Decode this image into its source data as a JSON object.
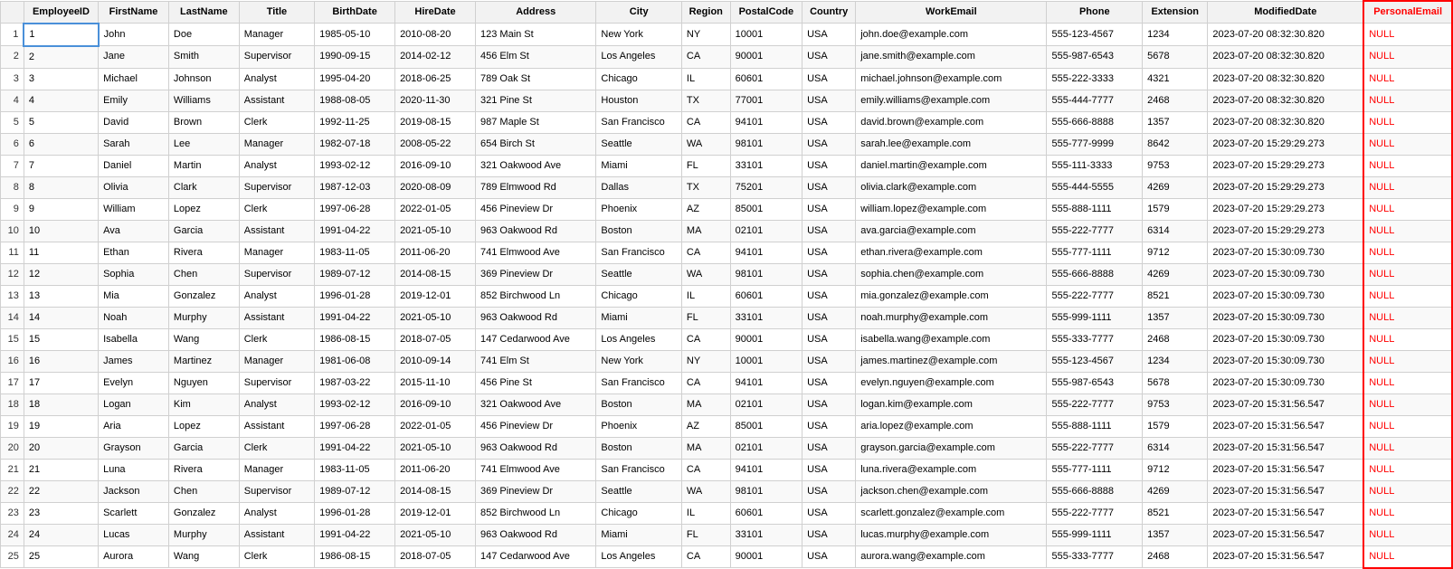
{
  "columns": [
    {
      "key": "rownum",
      "label": "",
      "class": ""
    },
    {
      "key": "EmployeeID",
      "label": "EmployeeID",
      "class": "col-employeeid"
    },
    {
      "key": "FirstName",
      "label": "FirstName",
      "class": "col-firstname"
    },
    {
      "key": "LastName",
      "label": "LastName",
      "class": "col-lastname"
    },
    {
      "key": "Title",
      "label": "Title",
      "class": "col-title"
    },
    {
      "key": "BirthDate",
      "label": "BirthDate",
      "class": "col-birthdate"
    },
    {
      "key": "HireDate",
      "label": "HireDate",
      "class": "col-hiredate"
    },
    {
      "key": "Address",
      "label": "Address",
      "class": "col-address"
    },
    {
      "key": "City",
      "label": "City",
      "class": "col-city"
    },
    {
      "key": "Region",
      "label": "Region",
      "class": "col-region"
    },
    {
      "key": "PostalCode",
      "label": "PostalCode",
      "class": "col-postalcode"
    },
    {
      "key": "Country",
      "label": "Country",
      "class": "col-country"
    },
    {
      "key": "WorkEmail",
      "label": "WorkEmail",
      "class": "col-workemail"
    },
    {
      "key": "Phone",
      "label": "Phone",
      "class": "col-phone"
    },
    {
      "key": "Extension",
      "label": "Extension",
      "class": "col-extension"
    },
    {
      "key": "ModifiedDate",
      "label": "ModifiedDate",
      "class": "col-modifieddate"
    },
    {
      "key": "PersonalEmail",
      "label": "PersonalEmail",
      "class": "col-personalemail"
    }
  ],
  "rows": [
    {
      "rownum": "1",
      "EmployeeID": "1",
      "FirstName": "John",
      "LastName": "Doe",
      "Title": "Manager",
      "BirthDate": "1985-05-10",
      "HireDate": "2010-08-20",
      "Address": "123 Main St",
      "City": "New York",
      "Region": "NY",
      "PostalCode": "10001",
      "Country": "USA",
      "WorkEmail": "john.doe@example.com",
      "Phone": "555-123-4567",
      "Extension": "1234",
      "ModifiedDate": "2023-07-20 08:32:30.820",
      "PersonalEmail": "NULL"
    },
    {
      "rownum": "2",
      "EmployeeID": "2",
      "FirstName": "Jane",
      "LastName": "Smith",
      "Title": "Supervisor",
      "BirthDate": "1990-09-15",
      "HireDate": "2014-02-12",
      "Address": "456 Elm St",
      "City": "Los Angeles",
      "Region": "CA",
      "PostalCode": "90001",
      "Country": "USA",
      "WorkEmail": "jane.smith@example.com",
      "Phone": "555-987-6543",
      "Extension": "5678",
      "ModifiedDate": "2023-07-20 08:32:30.820",
      "PersonalEmail": "NULL"
    },
    {
      "rownum": "3",
      "EmployeeID": "3",
      "FirstName": "Michael",
      "LastName": "Johnson",
      "Title": "Analyst",
      "BirthDate": "1995-04-20",
      "HireDate": "2018-06-25",
      "Address": "789 Oak St",
      "City": "Chicago",
      "Region": "IL",
      "PostalCode": "60601",
      "Country": "USA",
      "WorkEmail": "michael.johnson@example.com",
      "Phone": "555-222-3333",
      "Extension": "4321",
      "ModifiedDate": "2023-07-20 08:32:30.820",
      "PersonalEmail": "NULL"
    },
    {
      "rownum": "4",
      "EmployeeID": "4",
      "FirstName": "Emily",
      "LastName": "Williams",
      "Title": "Assistant",
      "BirthDate": "1988-08-05",
      "HireDate": "2020-11-30",
      "Address": "321 Pine St",
      "City": "Houston",
      "Region": "TX",
      "PostalCode": "77001",
      "Country": "USA",
      "WorkEmail": "emily.williams@example.com",
      "Phone": "555-444-7777",
      "Extension": "2468",
      "ModifiedDate": "2023-07-20 08:32:30.820",
      "PersonalEmail": "NULL"
    },
    {
      "rownum": "5",
      "EmployeeID": "5",
      "FirstName": "David",
      "LastName": "Brown",
      "Title": "Clerk",
      "BirthDate": "1992-11-25",
      "HireDate": "2019-08-15",
      "Address": "987 Maple St",
      "City": "San Francisco",
      "Region": "CA",
      "PostalCode": "94101",
      "Country": "USA",
      "WorkEmail": "david.brown@example.com",
      "Phone": "555-666-8888",
      "Extension": "1357",
      "ModifiedDate": "2023-07-20 08:32:30.820",
      "PersonalEmail": "NULL"
    },
    {
      "rownum": "6",
      "EmployeeID": "6",
      "FirstName": "Sarah",
      "LastName": "Lee",
      "Title": "Manager",
      "BirthDate": "1982-07-18",
      "HireDate": "2008-05-22",
      "Address": "654 Birch St",
      "City": "Seattle",
      "Region": "WA",
      "PostalCode": "98101",
      "Country": "USA",
      "WorkEmail": "sarah.lee@example.com",
      "Phone": "555-777-9999",
      "Extension": "8642",
      "ModifiedDate": "2023-07-20 15:29:29.273",
      "PersonalEmail": "NULL"
    },
    {
      "rownum": "7",
      "EmployeeID": "7",
      "FirstName": "Daniel",
      "LastName": "Martin",
      "Title": "Analyst",
      "BirthDate": "1993-02-12",
      "HireDate": "2016-09-10",
      "Address": "321 Oakwood Ave",
      "City": "Miami",
      "Region": "FL",
      "PostalCode": "33101",
      "Country": "USA",
      "WorkEmail": "daniel.martin@example.com",
      "Phone": "555-111-3333",
      "Extension": "9753",
      "ModifiedDate": "2023-07-20 15:29:29.273",
      "PersonalEmail": "NULL"
    },
    {
      "rownum": "8",
      "EmployeeID": "8",
      "FirstName": "Olivia",
      "LastName": "Clark",
      "Title": "Supervisor",
      "BirthDate": "1987-12-03",
      "HireDate": "2020-08-09",
      "Address": "789 Elmwood Rd",
      "City": "Dallas",
      "Region": "TX",
      "PostalCode": "75201",
      "Country": "USA",
      "WorkEmail": "olivia.clark@example.com",
      "Phone": "555-444-5555",
      "Extension": "4269",
      "ModifiedDate": "2023-07-20 15:29:29.273",
      "PersonalEmail": "NULL"
    },
    {
      "rownum": "9",
      "EmployeeID": "9",
      "FirstName": "William",
      "LastName": "Lopez",
      "Title": "Clerk",
      "BirthDate": "1997-06-28",
      "HireDate": "2022-01-05",
      "Address": "456 Pineview Dr",
      "City": "Phoenix",
      "Region": "AZ",
      "PostalCode": "85001",
      "Country": "USA",
      "WorkEmail": "william.lopez@example.com",
      "Phone": "555-888-1111",
      "Extension": "1579",
      "ModifiedDate": "2023-07-20 15:29:29.273",
      "PersonalEmail": "NULL"
    },
    {
      "rownum": "10",
      "EmployeeID": "10",
      "FirstName": "Ava",
      "LastName": "Garcia",
      "Title": "Assistant",
      "BirthDate": "1991-04-22",
      "HireDate": "2021-05-10",
      "Address": "963 Oakwood Rd",
      "City": "Boston",
      "Region": "MA",
      "PostalCode": "02101",
      "Country": "USA",
      "WorkEmail": "ava.garcia@example.com",
      "Phone": "555-222-7777",
      "Extension": "6314",
      "ModifiedDate": "2023-07-20 15:29:29.273",
      "PersonalEmail": "NULL"
    },
    {
      "rownum": "11",
      "EmployeeID": "11",
      "FirstName": "Ethan",
      "LastName": "Rivera",
      "Title": "Manager",
      "BirthDate": "1983-11-05",
      "HireDate": "2011-06-20",
      "Address": "741 Elmwood Ave",
      "City": "San Francisco",
      "Region": "CA",
      "PostalCode": "94101",
      "Country": "USA",
      "WorkEmail": "ethan.rivera@example.com",
      "Phone": "555-777-1111",
      "Extension": "9712",
      "ModifiedDate": "2023-07-20 15:30:09.730",
      "PersonalEmail": "NULL"
    },
    {
      "rownum": "12",
      "EmployeeID": "12",
      "FirstName": "Sophia",
      "LastName": "Chen",
      "Title": "Supervisor",
      "BirthDate": "1989-07-12",
      "HireDate": "2014-08-15",
      "Address": "369 Pineview Dr",
      "City": "Seattle",
      "Region": "WA",
      "PostalCode": "98101",
      "Country": "USA",
      "WorkEmail": "sophia.chen@example.com",
      "Phone": "555-666-8888",
      "Extension": "4269",
      "ModifiedDate": "2023-07-20 15:30:09.730",
      "PersonalEmail": "NULL"
    },
    {
      "rownum": "13",
      "EmployeeID": "13",
      "FirstName": "Mia",
      "LastName": "Gonzalez",
      "Title": "Analyst",
      "BirthDate": "1996-01-28",
      "HireDate": "2019-12-01",
      "Address": "852 Birchwood Ln",
      "City": "Chicago",
      "Region": "IL",
      "PostalCode": "60601",
      "Country": "USA",
      "WorkEmail": "mia.gonzalez@example.com",
      "Phone": "555-222-7777",
      "Extension": "8521",
      "ModifiedDate": "2023-07-20 15:30:09.730",
      "PersonalEmail": "NULL"
    },
    {
      "rownum": "14",
      "EmployeeID": "14",
      "FirstName": "Noah",
      "LastName": "Murphy",
      "Title": "Assistant",
      "BirthDate": "1991-04-22",
      "HireDate": "2021-05-10",
      "Address": "963 Oakwood Rd",
      "City": "Miami",
      "Region": "FL",
      "PostalCode": "33101",
      "Country": "USA",
      "WorkEmail": "noah.murphy@example.com",
      "Phone": "555-999-1111",
      "Extension": "1357",
      "ModifiedDate": "2023-07-20 15:30:09.730",
      "PersonalEmail": "NULL"
    },
    {
      "rownum": "15",
      "EmployeeID": "15",
      "FirstName": "Isabella",
      "LastName": "Wang",
      "Title": "Clerk",
      "BirthDate": "1986-08-15",
      "HireDate": "2018-07-05",
      "Address": "147 Cedarwood Ave",
      "City": "Los Angeles",
      "Region": "CA",
      "PostalCode": "90001",
      "Country": "USA",
      "WorkEmail": "isabella.wang@example.com",
      "Phone": "555-333-7777",
      "Extension": "2468",
      "ModifiedDate": "2023-07-20 15:30:09.730",
      "PersonalEmail": "NULL"
    },
    {
      "rownum": "16",
      "EmployeeID": "16",
      "FirstName": "James",
      "LastName": "Martinez",
      "Title": "Manager",
      "BirthDate": "1981-06-08",
      "HireDate": "2010-09-14",
      "Address": "741 Elm St",
      "City": "New York",
      "Region": "NY",
      "PostalCode": "10001",
      "Country": "USA",
      "WorkEmail": "james.martinez@example.com",
      "Phone": "555-123-4567",
      "Extension": "1234",
      "ModifiedDate": "2023-07-20 15:30:09.730",
      "PersonalEmail": "NULL"
    },
    {
      "rownum": "17",
      "EmployeeID": "17",
      "FirstName": "Evelyn",
      "LastName": "Nguyen",
      "Title": "Supervisor",
      "BirthDate": "1987-03-22",
      "HireDate": "2015-11-10",
      "Address": "456 Pine St",
      "City": "San Francisco",
      "Region": "CA",
      "PostalCode": "94101",
      "Country": "USA",
      "WorkEmail": "evelyn.nguyen@example.com",
      "Phone": "555-987-6543",
      "Extension": "5678",
      "ModifiedDate": "2023-07-20 15:30:09.730",
      "PersonalEmail": "NULL"
    },
    {
      "rownum": "18",
      "EmployeeID": "18",
      "FirstName": "Logan",
      "LastName": "Kim",
      "Title": "Analyst",
      "BirthDate": "1993-02-12",
      "HireDate": "2016-09-10",
      "Address": "321 Oakwood Ave",
      "City": "Boston",
      "Region": "MA",
      "PostalCode": "02101",
      "Country": "USA",
      "WorkEmail": "logan.kim@example.com",
      "Phone": "555-222-7777",
      "Extension": "9753",
      "ModifiedDate": "2023-07-20 15:31:56.547",
      "PersonalEmail": "NULL"
    },
    {
      "rownum": "19",
      "EmployeeID": "19",
      "FirstName": "Aria",
      "LastName": "Lopez",
      "Title": "Assistant",
      "BirthDate": "1997-06-28",
      "HireDate": "2022-01-05",
      "Address": "456 Pineview Dr",
      "City": "Phoenix",
      "Region": "AZ",
      "PostalCode": "85001",
      "Country": "USA",
      "WorkEmail": "aria.lopez@example.com",
      "Phone": "555-888-1111",
      "Extension": "1579",
      "ModifiedDate": "2023-07-20 15:31:56.547",
      "PersonalEmail": "NULL"
    },
    {
      "rownum": "20",
      "EmployeeID": "20",
      "FirstName": "Grayson",
      "LastName": "Garcia",
      "Title": "Clerk",
      "BirthDate": "1991-04-22",
      "HireDate": "2021-05-10",
      "Address": "963 Oakwood Rd",
      "City": "Boston",
      "Region": "MA",
      "PostalCode": "02101",
      "Country": "USA",
      "WorkEmail": "grayson.garcia@example.com",
      "Phone": "555-222-7777",
      "Extension": "6314",
      "ModifiedDate": "2023-07-20 15:31:56.547",
      "PersonalEmail": "NULL"
    },
    {
      "rownum": "21",
      "EmployeeID": "21",
      "FirstName": "Luna",
      "LastName": "Rivera",
      "Title": "Manager",
      "BirthDate": "1983-11-05",
      "HireDate": "2011-06-20",
      "Address": "741 Elmwood Ave",
      "City": "San Francisco",
      "Region": "CA",
      "PostalCode": "94101",
      "Country": "USA",
      "WorkEmail": "luna.rivera@example.com",
      "Phone": "555-777-1111",
      "Extension": "9712",
      "ModifiedDate": "2023-07-20 15:31:56.547",
      "PersonalEmail": "NULL"
    },
    {
      "rownum": "22",
      "EmployeeID": "22",
      "FirstName": "Jackson",
      "LastName": "Chen",
      "Title": "Supervisor",
      "BirthDate": "1989-07-12",
      "HireDate": "2014-08-15",
      "Address": "369 Pineview Dr",
      "City": "Seattle",
      "Region": "WA",
      "PostalCode": "98101",
      "Country": "USA",
      "WorkEmail": "jackson.chen@example.com",
      "Phone": "555-666-8888",
      "Extension": "4269",
      "ModifiedDate": "2023-07-20 15:31:56.547",
      "PersonalEmail": "NULL"
    },
    {
      "rownum": "23",
      "EmployeeID": "23",
      "FirstName": "Scarlett",
      "LastName": "Gonzalez",
      "Title": "Analyst",
      "BirthDate": "1996-01-28",
      "HireDate": "2019-12-01",
      "Address": "852 Birchwood Ln",
      "City": "Chicago",
      "Region": "IL",
      "PostalCode": "60601",
      "Country": "USA",
      "WorkEmail": "scarlett.gonzalez@example.com",
      "Phone": "555-222-7777",
      "Extension": "8521",
      "ModifiedDate": "2023-07-20 15:31:56.547",
      "PersonalEmail": "NULL"
    },
    {
      "rownum": "24",
      "EmployeeID": "24",
      "FirstName": "Lucas",
      "LastName": "Murphy",
      "Title": "Assistant",
      "BirthDate": "1991-04-22",
      "HireDate": "2021-05-10",
      "Address": "963 Oakwood Rd",
      "City": "Miami",
      "Region": "FL",
      "PostalCode": "33101",
      "Country": "USA",
      "WorkEmail": "lucas.murphy@example.com",
      "Phone": "555-999-1111",
      "Extension": "1357",
      "ModifiedDate": "2023-07-20 15:31:56.547",
      "PersonalEmail": "NULL"
    },
    {
      "rownum": "25",
      "EmployeeID": "25",
      "FirstName": "Aurora",
      "LastName": "Wang",
      "Title": "Clerk",
      "BirthDate": "1986-08-15",
      "HireDate": "2018-07-05",
      "Address": "147 Cedarwood Ave",
      "City": "Los Angeles",
      "Region": "CA",
      "PostalCode": "90001",
      "Country": "USA",
      "WorkEmail": "aurora.wang@example.com",
      "Phone": "555-333-7777",
      "Extension": "2468",
      "ModifiedDate": "2023-07-20 15:31:56.547",
      "PersonalEmail": "NULL"
    }
  ]
}
